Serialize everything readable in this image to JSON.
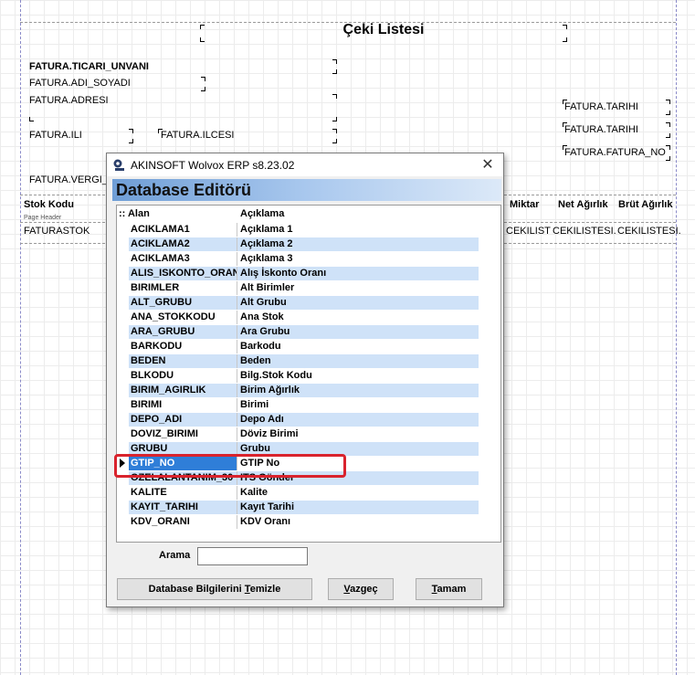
{
  "report": {
    "title": "Çeki Listesi",
    "fields": {
      "ticari_unvani": "FATURA.TICARI_UNVANI",
      "adi_soyadi": "FATURA.ADI_SOYADI",
      "adresi": "FATURA.ADRESI",
      "ili": "FATURA.ILI",
      "ilcesi": "FATURA.ILCESI",
      "vergi": "FATURA.VERGI_D",
      "tarihi1": "FATURA.TARIHI",
      "tarihi2": "FATURA.TARIHI",
      "fatura_no": "FATURA.FATURA_NO"
    },
    "columns": {
      "stok_kodu": "Stok Kodu",
      "miktar": "Miktar",
      "net_agirlik": "Net Ağırlık",
      "brut_agirlik": "Brüt Ağırlık"
    },
    "page_header_label": "Page Header",
    "data_cells": {
      "faturastok": "FATURASTOK",
      "cekilist": "CEKILIST",
      "cekilistesi1": "CEKILISTESI.",
      "cekilistesi2": "CEKILISTESI."
    }
  },
  "dialog": {
    "title": "AKINSOFT Wolvox ERP s8.23.02",
    "close_label": "✕",
    "banner": "Database Editörü",
    "grid": {
      "header_col1": ":: Alan",
      "header_col2": "Açıklama",
      "rows": [
        {
          "alan": "ACIKLAMA1",
          "aciklama": "Açıklama 1"
        },
        {
          "alan": "ACIKLAMA2",
          "aciklama": "Açıklama 2"
        },
        {
          "alan": "ACIKLAMA3",
          "aciklama": "Açıklama 3"
        },
        {
          "alan": "ALIS_ISKONTO_ORANI",
          "aciklama": "Alış İskonto Oranı"
        },
        {
          "alan": "BIRIMLER",
          "aciklama": "Alt Birimler"
        },
        {
          "alan": "ALT_GRUBU",
          "aciklama": "Alt Grubu"
        },
        {
          "alan": "ANA_STOKKODU",
          "aciklama": "Ana Stok"
        },
        {
          "alan": "ARA_GRUBU",
          "aciklama": "Ara Grubu"
        },
        {
          "alan": "BARKODU",
          "aciklama": "Barkodu"
        },
        {
          "alan": "BEDEN",
          "aciklama": "Beden"
        },
        {
          "alan": "BLKODU",
          "aciklama": "Bilg.Stok Kodu"
        },
        {
          "alan": "BIRIM_AGIRLIK",
          "aciklama": "Birim Ağırlık"
        },
        {
          "alan": "BIRIMI",
          "aciklama": "Birimi"
        },
        {
          "alan": "DEPO_ADI",
          "aciklama": "Depo Adı"
        },
        {
          "alan": "DOVIZ_BIRIMI",
          "aciklama": "Döviz Birimi"
        },
        {
          "alan": "GRUBU",
          "aciklama": "Grubu"
        },
        {
          "alan": "GTIP_NO",
          "aciklama": "GTIP No"
        },
        {
          "alan": "OZELALANTANIM_30",
          "aciklama": "ITS Gönder"
        },
        {
          "alan": "KALITE",
          "aciklama": "Kalite"
        },
        {
          "alan": "KAYIT_TARIHI",
          "aciklama": "Kayıt Tarihi"
        },
        {
          "alan": "KDV_ORANI",
          "aciklama": "KDV Oranı"
        }
      ],
      "selected_index": 16
    },
    "search_label": "Arama",
    "search_value": "",
    "buttons": {
      "clear": "Database Bilgilerini Temizle",
      "cancel": "Vazgeç",
      "ok": "Tamam"
    },
    "colors": {
      "row_alt": "#cfe2f8",
      "selected": "#2f7ed8",
      "highlight": "#d9232d"
    }
  }
}
